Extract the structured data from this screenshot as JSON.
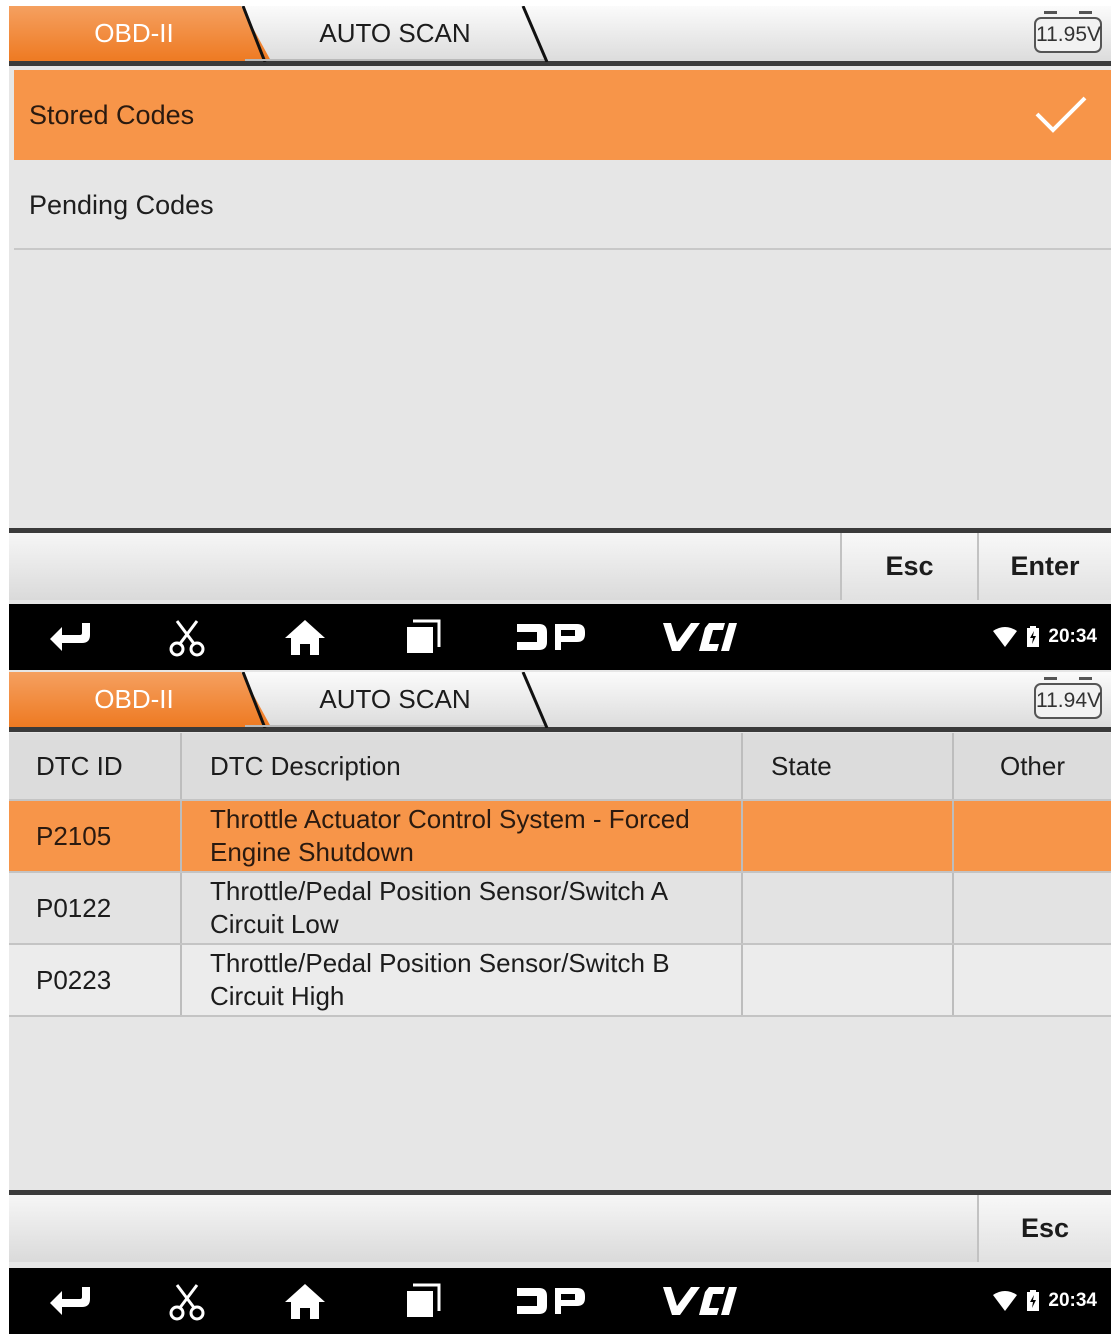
{
  "screen1": {
    "tabs": {
      "active": "OBD-II",
      "second": "AUTO SCAN"
    },
    "battery": "11.95V",
    "list": {
      "items": [
        {
          "label": "Stored Codes",
          "selected": true
        },
        {
          "label": "Pending Codes",
          "selected": false
        }
      ]
    },
    "buttons": {
      "esc": "Esc",
      "enter": "Enter"
    },
    "status": {
      "time": "20:34"
    }
  },
  "screen2": {
    "tabs": {
      "active": "OBD-II",
      "second": "AUTO SCAN"
    },
    "battery": "11.94V",
    "table": {
      "headers": [
        "DTC ID",
        "DTC Description",
        "State",
        "Other"
      ],
      "rows": [
        {
          "id": "P2105",
          "description": "Throttle Actuator Control System - Forced Engine Shutdown",
          "state": "",
          "other": ""
        },
        {
          "id": "P0122",
          "description": "Throttle/Pedal Position Sensor/Switch A Circuit Low",
          "state": "",
          "other": ""
        },
        {
          "id": "P0223",
          "description": "Throttle/Pedal Position Sensor/Switch B Circuit High",
          "state": "",
          "other": ""
        }
      ]
    },
    "buttons": {
      "esc": "Esc"
    },
    "status": {
      "time": "20:34"
    }
  },
  "nav_icons": [
    "back-icon",
    "scissors-icon",
    "home-icon",
    "recent-apps-icon",
    "dp-icon",
    "vci-icon"
  ],
  "colors": {
    "accent": "#F79549",
    "tab_orange": "#EE7A22",
    "nav_bg": "#000000"
  }
}
